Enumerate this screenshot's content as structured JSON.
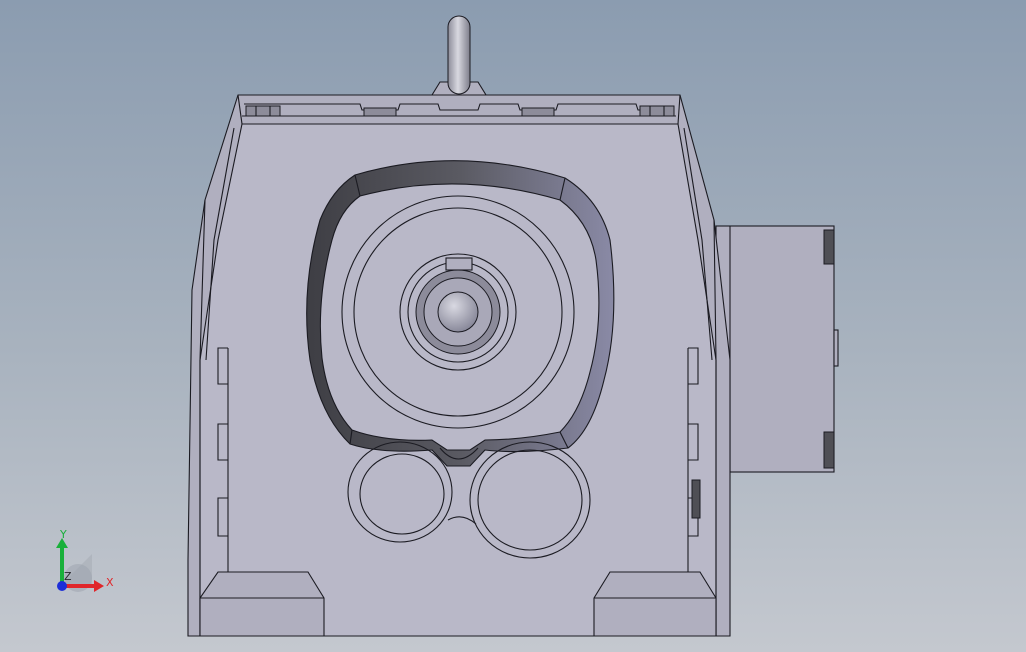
{
  "triad": {
    "x_label": "X",
    "y_label": "Y",
    "z_label": "Z",
    "x_color": "#e0262a",
    "y_color": "#19b03a",
    "z_color": "#1d2ed8"
  },
  "colors": {
    "background_top": "#8b9cb0",
    "background_bottom": "#c4c8cf",
    "body_face": "#b0afbf",
    "edge_line": "#1b1b22"
  }
}
